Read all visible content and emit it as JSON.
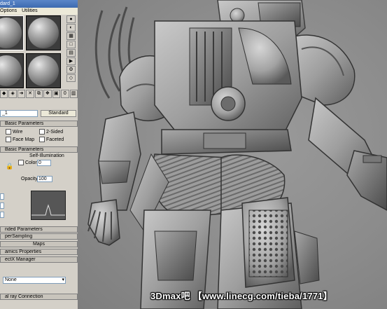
{
  "material_editor": {
    "title": "dard_1",
    "menu": [
      "Options",
      "Utilities"
    ],
    "material_name": "_1",
    "type_button": "Standard",
    "rollouts": {
      "basic_params": "Basic Parameters",
      "blinn_basic_params": "Basic Parameters",
      "extended_params": "nded Parameters",
      "supersampling": "perSampling",
      "maps": "Maps",
      "dynamics": "amics Properties",
      "directx": "ectX Manager",
      "mental_ray": "al ray Connection"
    },
    "checkboxes": {
      "wire": "Wire",
      "two_sided": "2-Sided",
      "face_map": "Face Map",
      "faceted": "Faceted"
    },
    "self_illum": {
      "group_label": "Self-Illumination",
      "color_label": "Color",
      "color_value": "0"
    },
    "opacity": {
      "label": "Opacity",
      "value": "100"
    },
    "directx_dropdown": "None"
  },
  "viewport": {
    "watermark": "3Dmax吧 【www.linecg.com/tieba/1771】"
  }
}
